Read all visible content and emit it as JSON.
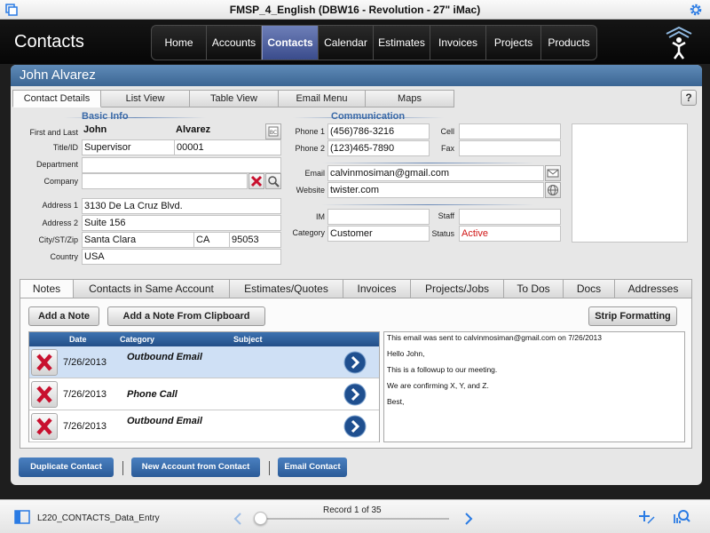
{
  "window": {
    "title": "FMSP_4_English (DBW16 - Revolution - 27\" iMac)"
  },
  "header": {
    "app_title": "Contacts",
    "nav": [
      {
        "label": "Home",
        "active": false
      },
      {
        "label": "Accounts",
        "active": false
      },
      {
        "label": "Contacts",
        "active": true
      },
      {
        "label": "Calendar",
        "active": false
      },
      {
        "label": "Estimates",
        "active": false
      },
      {
        "label": "Invoices",
        "active": false
      },
      {
        "label": "Projects",
        "active": false
      },
      {
        "label": "Products",
        "active": false
      }
    ]
  },
  "contact": {
    "full_name": "John Alvarez"
  },
  "top_tabs": [
    {
      "label": "Contact Details",
      "active": true
    },
    {
      "label": "List View"
    },
    {
      "label": "Table View"
    },
    {
      "label": "Email Menu"
    },
    {
      "label": "Maps"
    }
  ],
  "help_label": "?",
  "basic_info": {
    "title": "Basic Info",
    "first_last_label": "First and Last",
    "first_name": "John",
    "last_name": "Alvarez",
    "title_id_label": "Title/ID",
    "job_title": "Supervisor",
    "id": "00001",
    "department_label": "Department",
    "department": "",
    "company_label": "Company",
    "company": "",
    "address1_label": "Address 1",
    "address1": "3130 De La Cruz Blvd.",
    "address2_label": "Address 2",
    "address2": "Suite 156",
    "city_state_zip_label": "City/ST/Zip",
    "city": "Santa Clara",
    "state": "CA",
    "zip": "95053",
    "country_label": "Country",
    "country": "USA"
  },
  "communication": {
    "title": "Communication",
    "phone1_label": "Phone 1",
    "phone1": "(456)786-3216",
    "phone2_label": "Phone 2",
    "phone2": "(123)465-7890",
    "cell_label": "Cell",
    "cell": "",
    "fax_label": "Fax",
    "fax": "",
    "email_label": "Email",
    "email": "calvinmosiman@gmail.com",
    "website_label": "Website",
    "website": "twister.com",
    "im_label": "IM",
    "im": "",
    "staff_label": "Staff",
    "staff": "",
    "category_label": "Category",
    "category": "Customer",
    "status_label": "Status",
    "status": "Active",
    "status_color": "#d01515"
  },
  "lower_tabs": [
    {
      "label": "Notes",
      "active": true
    },
    {
      "label": "Contacts in Same Account"
    },
    {
      "label": "Estimates/Quotes"
    },
    {
      "label": "Invoices"
    },
    {
      "label": "Projects/Jobs"
    },
    {
      "label": "To Dos"
    },
    {
      "label": "Docs"
    },
    {
      "label": "Addresses"
    }
  ],
  "notes_panel": {
    "add_note_label": "Add a Note",
    "add_clipboard_label": "Add a Note From Clipboard",
    "strip_formatting_label": "Strip Formatting",
    "columns": {
      "date": "Date",
      "category": "Category",
      "subject": "Subject"
    },
    "rows": [
      {
        "date": "7/26/2013",
        "category": "Outbound Email",
        "selected": true
      },
      {
        "date": "7/26/2013",
        "category": "Phone Call",
        "selected": false
      },
      {
        "date": "7/26/2013",
        "category": "Outbound Email",
        "selected": false
      }
    ],
    "note_text": [
      "This email was sent to calvinmosiman@gmail.com on 7/26/2013",
      "Hello John,",
      "This is a followup to our meeting.",
      "We are confirming X, Y, and Z.",
      "Best,"
    ]
  },
  "actions": {
    "duplicate_label": "Duplicate Contact",
    "new_account_label": "New Account from Contact",
    "email_contact_label": "Email Contact"
  },
  "bottombar": {
    "layout_name": "L220_CONTACTS_Data_Entry",
    "record_text": "Record 1 of 35",
    "record_current": 1,
    "record_total": 35
  },
  "colors": {
    "accent_blue": "#3b6593",
    "nav_active": "#4f60a0",
    "delete_red": "#c8102e"
  }
}
